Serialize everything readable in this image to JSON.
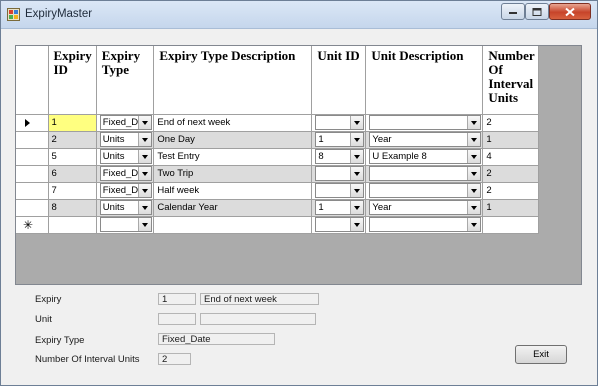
{
  "window": {
    "title": "ExpiryMaster"
  },
  "grid": {
    "headers": {
      "expiry_id": "Expiry ID",
      "expiry_type": "Expiry Type",
      "expiry_type_description": "Expiry Type Description",
      "unit_id": "Unit ID",
      "unit_description": "Unit Description",
      "number_of_interval_units": "Number Of Interval Units"
    },
    "rows": [
      {
        "id": "1",
        "type": "Fixed_Date",
        "desc": "End of next week",
        "unit_id": "",
        "unit_desc": "",
        "num": "2"
      },
      {
        "id": "2",
        "type": "Units",
        "desc": "One Day",
        "unit_id": "1",
        "unit_desc": "Year",
        "num": "1"
      },
      {
        "id": "5",
        "type": "Units",
        "desc": "Test Entry",
        "unit_id": "8",
        "unit_desc": "U Example 8",
        "num": "4"
      },
      {
        "id": "6",
        "type": "Fixed_Date",
        "desc": "Two Trip",
        "unit_id": "",
        "unit_desc": "",
        "num": "2"
      },
      {
        "id": "7",
        "type": "Fixed_Date",
        "desc": "Half week",
        "unit_id": "",
        "unit_desc": "",
        "num": "2"
      },
      {
        "id": "8",
        "type": "Units",
        "desc": "Calendar Year",
        "unit_id": "1",
        "unit_desc": "Year",
        "num": "1"
      }
    ],
    "current_row_marker": "►",
    "new_row_marker": "✳"
  },
  "form": {
    "expiry_label": "Expiry",
    "expiry_id_value": "1",
    "expiry_desc_value": "End of next week",
    "unit_label": "Unit",
    "unit_id_value": "",
    "unit_desc_value": "",
    "expiry_type_label": "Expiry Type",
    "expiry_type_value": "Fixed_Date",
    "interval_label": "Number Of Interval Units",
    "interval_value": "2"
  },
  "buttons": {
    "exit": "Exit"
  },
  "colors": {
    "selected_cell": "#ffff80",
    "grid_background": "#ababab",
    "alt_row": "#dcdcdc"
  },
  "icons": [
    "app-icon",
    "minimize-icon",
    "maximize-icon",
    "close-icon",
    "current-row-icon",
    "new-row-icon",
    "dropdown-arrow-icon"
  ]
}
